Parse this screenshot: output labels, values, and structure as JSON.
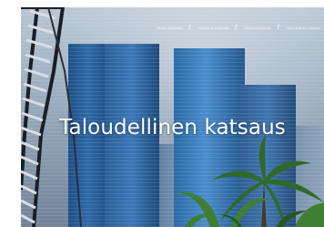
{
  "hero": {
    "title": "Taloudellinen katsaus",
    "background": "skyscrapers-and-palms-photo"
  },
  "breadcrumb": {
    "items": [
      {
        "label": "Tietoa sijoittajille"
      },
      {
        "label": "Raportit ja esitykset"
      },
      {
        "label": "Osavuosikatsaus"
      },
      {
        "label": "Taloudellinen katsaus"
      }
    ],
    "separator": "/"
  },
  "colors": {
    "title_text": "#ffffff",
    "sky": "#9eb0c2",
    "glass_blue": "#2f6aa8",
    "palm_green": "#2f6a2a"
  }
}
